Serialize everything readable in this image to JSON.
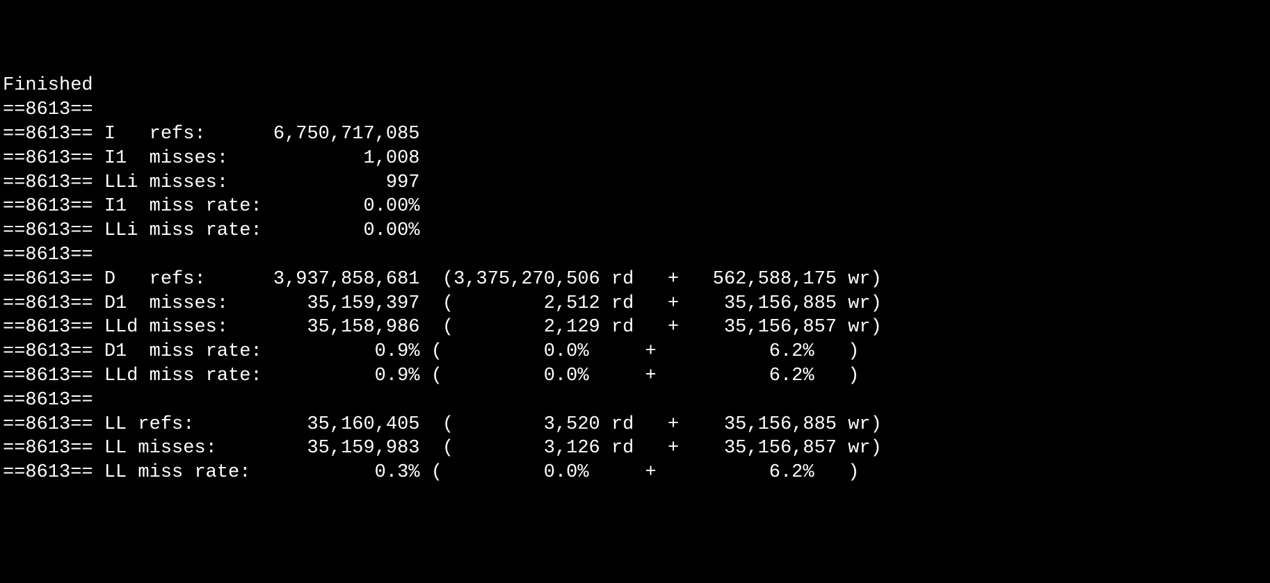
{
  "pid": "8613",
  "header": "Finished",
  "instruction": {
    "I_refs": "6,750,717,085",
    "I1_misses": "1,008",
    "LLi_misses": "997",
    "I1_miss_rate": "0.00%",
    "LLi_miss_rate": "0.00%"
  },
  "data": {
    "D_refs": {
      "total": "3,937,858,681",
      "rd": "3,375,270,506",
      "wr": "562,588,175"
    },
    "D1_misses": {
      "total": "35,159,397",
      "rd": "2,512",
      "wr": "35,156,885"
    },
    "LLd_misses": {
      "total": "35,158,986",
      "rd": "2,129",
      "wr": "35,156,857"
    },
    "D1_miss_rate": {
      "total": "0.9%",
      "rd": "0.0%",
      "wr": "6.2%"
    },
    "LLd_miss_rate": {
      "total": "0.9%",
      "rd": "0.0%",
      "wr": "6.2%"
    }
  },
  "ll": {
    "LL_refs": {
      "total": "35,160,405",
      "rd": "3,520",
      "wr": "35,156,885"
    },
    "LL_misses": {
      "total": "35,159,983",
      "rd": "3,126",
      "wr": "35,156,857"
    },
    "LL_miss_rate": {
      "total": "0.3%",
      "rd": "0.0%",
      "wr": "6.2%"
    }
  }
}
